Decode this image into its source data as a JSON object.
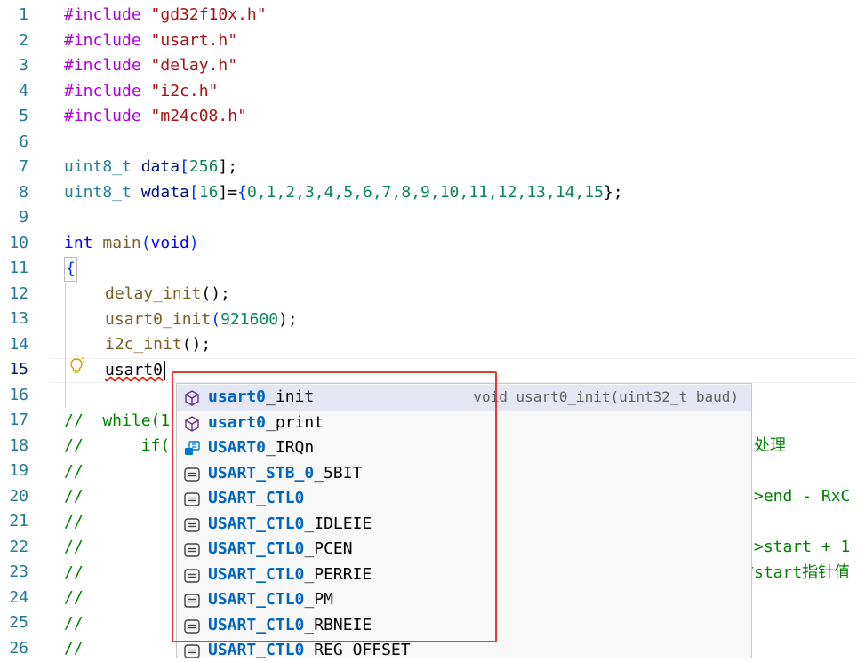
{
  "line_numbers": [
    "1",
    "2",
    "3",
    "4",
    "5",
    "6",
    "7",
    "8",
    "9",
    "10",
    "11",
    "12",
    "13",
    "14",
    "15",
    "16",
    "17",
    "18",
    "19",
    "20",
    "21",
    "22",
    "23",
    "24",
    "25",
    "26"
  ],
  "active_line": "15",
  "code": {
    "l1": {
      "kw": "#include",
      "str": " \"gd32f10x.h\""
    },
    "l2": {
      "kw": "#include",
      "str": " \"usart.h\""
    },
    "l3": {
      "kw": "#include",
      "str": " \"delay.h\""
    },
    "l4": {
      "kw": "#include",
      "str": " \"i2c.h\""
    },
    "l5": {
      "kw": "#include",
      "str": " \"m24c08.h\""
    },
    "l7": {
      "type": "uint8_t",
      "name": " data",
      "b1": "[",
      "num": "256",
      "b2": "];"
    },
    "l8": {
      "type": "uint8_t",
      "name": " wdata",
      "b1": "[",
      "num": "16",
      "b2": "]=",
      "open": "{",
      "values": "0,1,2,3,4,5,6,7,8,9,10,11,12,13,14,15",
      "close": "};"
    },
    "l10": {
      "kw": "int",
      "fn": " main",
      "p1": "(",
      "arg": "void",
      "p2": ")"
    },
    "l11": {
      "brace": "{"
    },
    "l12": {
      "fn": "delay_init",
      "rest": "();"
    },
    "l13": {
      "fn": "usart0_init",
      "p1": "(",
      "num": "921600",
      "p2": ");"
    },
    "l14": {
      "fn": "i2c_init",
      "rest": "();"
    },
    "l15": {
      "typed": "usart0"
    },
    "l17": {
      "cmt": "//  while(1"
    },
    "l18": {
      "cmt": "//      if("
    },
    "l19": {
      "cmt": "//"
    },
    "l20": {
      "cmt": "//"
    },
    "l21": {
      "cmt": "//"
    },
    "l22": {
      "cmt": "//"
    },
    "l23": {
      "cmt": "//"
    },
    "l24": {
      "cmt": "//"
    },
    "l25": {
      "cmt": "//"
    },
    "l26": {
      "cmt": "//"
    }
  },
  "right_fragments": {
    "l18": "处理",
    "l20": ">end - RxC",
    "l22": ">start + 1",
    "l23": "时start指针值"
  },
  "suggest": {
    "detail": "void usart0_init(uint32_t baud)",
    "items": [
      {
        "match": "usart0",
        "rest": "_init",
        "icon": "method-icon"
      },
      {
        "match": "usart0",
        "rest": "_print",
        "icon": "method-icon"
      },
      {
        "match": "USART0",
        "rest": "_IRQn",
        "icon": "enum-member-icon"
      },
      {
        "pre": "USART_STB_",
        "match": "0",
        "rest": "_5BIT",
        "icon": "constant-icon"
      },
      {
        "pre": "USART_CTL",
        "match": "0",
        "rest": "",
        "icon": "constant-icon"
      },
      {
        "pre": "USART_CTL",
        "match": "0",
        "rest": "_IDLEIE",
        "icon": "constant-icon"
      },
      {
        "pre": "USART_CTL",
        "match": "0",
        "rest": "_PCEN",
        "icon": "constant-icon"
      },
      {
        "pre": "USART_CTL",
        "match": "0",
        "rest": "_PERRIE",
        "icon": "constant-icon"
      },
      {
        "pre": "USART_CTL",
        "match": "0",
        "rest": "_PM",
        "icon": "constant-icon"
      },
      {
        "pre": "USART_CTL",
        "match": "0",
        "rest": "_RBNEIE",
        "icon": "constant-icon"
      },
      {
        "pre": "USART_CTL",
        "match": "0",
        "rest": "_REG_OFFSET",
        "icon": "constant-icon"
      }
    ]
  },
  "colors": {
    "highlight_box": "#e53935",
    "match": "#0066bf",
    "selected_row": "#e4e6f1"
  }
}
